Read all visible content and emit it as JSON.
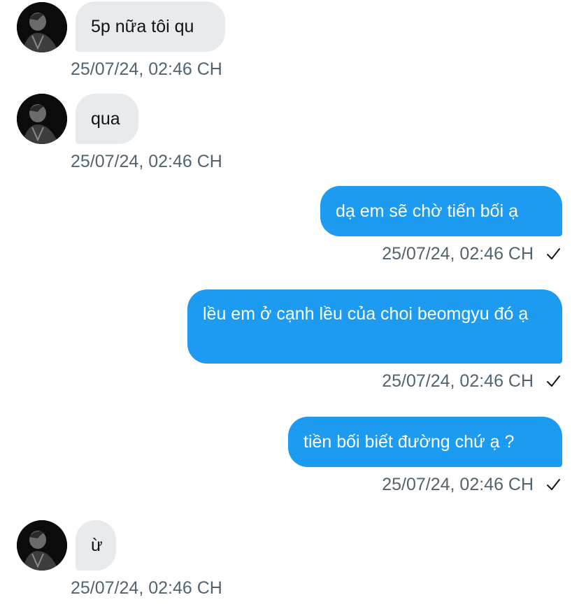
{
  "conversation": {
    "messages": [
      {
        "direction": "in",
        "text": "5p nữa tôi qu",
        "timestamp": "25/07/24, 02:46 CH"
      },
      {
        "direction": "in",
        "text": "qua",
        "timestamp": "25/07/24, 02:46 CH"
      },
      {
        "direction": "out",
        "text": "dạ em sẽ chờ tiến bối ạ",
        "timestamp": "25/07/24, 02:46 CH",
        "status_icon": "check-icon"
      },
      {
        "direction": "out",
        "text": "lều em ở cạnh lều của choi beomgyu đó ạ",
        "timestamp": "25/07/24, 02:46 CH",
        "status_icon": "check-icon"
      },
      {
        "direction": "out",
        "text": "tiền bối biết đường chứ ạ ?",
        "timestamp": "25/07/24, 02:46 CH",
        "status_icon": "check-icon"
      },
      {
        "direction": "in",
        "text": "ừ",
        "timestamp": "25/07/24, 02:46 CH"
      }
    ]
  },
  "colors": {
    "incoming_bubble": "#e7ebee",
    "outgoing_bubble": "#1d9bf0",
    "timestamp_text": "#536471",
    "background": "#ffffff"
  }
}
